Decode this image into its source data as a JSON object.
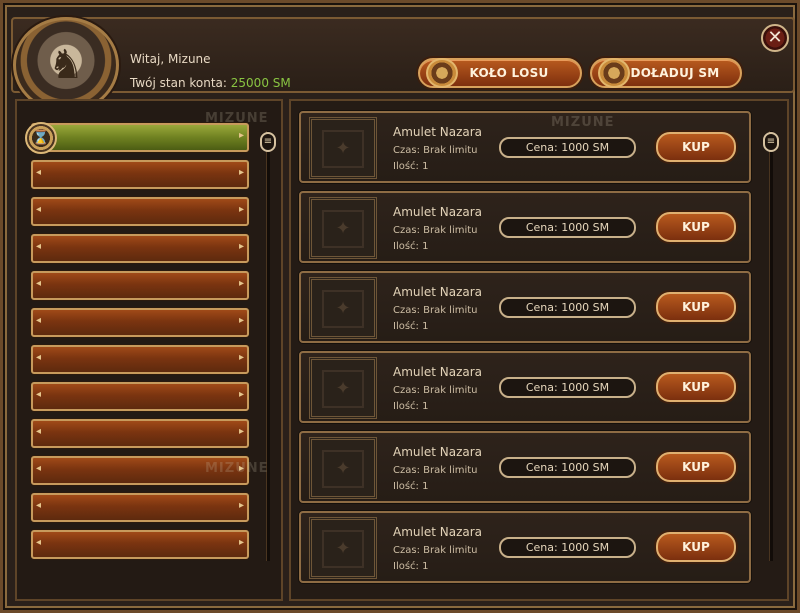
{
  "header": {
    "greeting": "Witaj, Mizune",
    "balance_label": "Twój stan konta:",
    "balance_value": "25000 SM",
    "wheel_button": "KOŁO LOSU",
    "topup_button": "DOŁADUJ SM",
    "close_symbol": "✕"
  },
  "categories": {
    "count": 12,
    "active_index": 0
  },
  "watermarks": [
    "MIZUNE",
    "MIZUNE",
    "MIZUNE"
  ],
  "items": [
    {
      "name": "Amulet Nazara",
      "time": "Czas: Brak limitu",
      "qty": "Ilość: 1",
      "price": "Cena: 1000 SM",
      "buy": "KUP"
    },
    {
      "name": "Amulet Nazara",
      "time": "Czas: Brak limitu",
      "qty": "Ilość: 1",
      "price": "Cena: 1000 SM",
      "buy": "KUP"
    },
    {
      "name": "Amulet Nazara",
      "time": "Czas: Brak limitu",
      "qty": "Ilość: 1",
      "price": "Cena: 1000 SM",
      "buy": "KUP"
    },
    {
      "name": "Amulet Nazara",
      "time": "Czas: Brak limitu",
      "qty": "Ilość: 1",
      "price": "Cena: 1000 SM",
      "buy": "KUP"
    },
    {
      "name": "Amulet Nazara",
      "time": "Czas: Brak limitu",
      "qty": "Ilość: 1",
      "price": "Cena: 1000 SM",
      "buy": "KUP"
    },
    {
      "name": "Amulet Nazara",
      "time": "Czas: Brak limitu",
      "qty": "Ilość: 1",
      "price": "Cena: 1000 SM",
      "buy": "KUP"
    }
  ],
  "icons": {
    "emblem": "deer-head-emblem-icon",
    "hourglass": "hourglass-icon",
    "scroll": "scroll-handle-icon",
    "item_slot": "empty-item-slot-icon"
  },
  "colors": {
    "balance": "#89c442",
    "button": "#b85a1e",
    "active_category": "#6f8121"
  }
}
